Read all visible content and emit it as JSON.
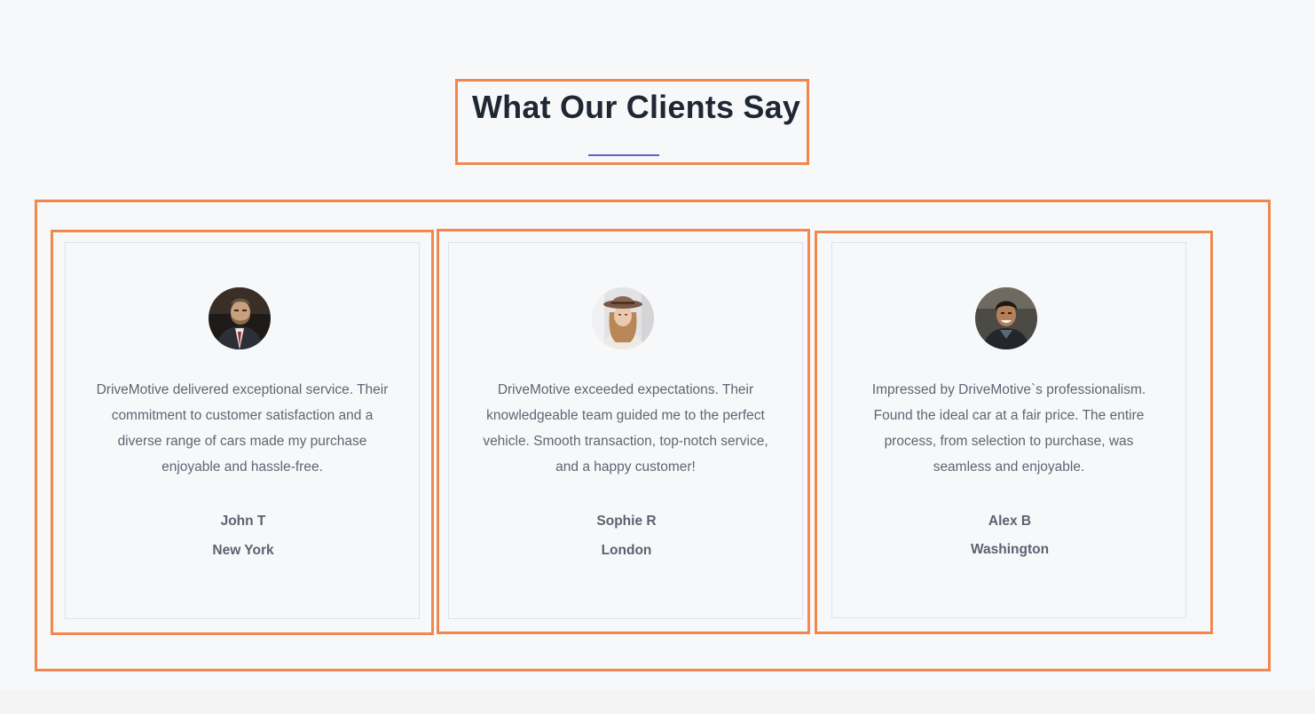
{
  "section": {
    "title": "What Our Clients Say",
    "accent_color": "#5a63c9",
    "highlight_color": "#f0884e"
  },
  "testimonials": [
    {
      "avatar_icon": "bearded-man-portrait",
      "quote": "DriveMotive delivered exceptional service. Their commitment to customer satisfaction and a diverse range of cars made my purchase enjoyable and hassle-free.",
      "name": "John T",
      "city": "New York"
    },
    {
      "avatar_icon": "woman-with-hat-portrait",
      "quote": "DriveMotive exceeded expectations. Their knowledgeable team guided me to the perfect vehicle. Smooth transaction, top-notch service, and a happy customer!",
      "name": "Sophie R",
      "city": "London"
    },
    {
      "avatar_icon": "smiling-man-portrait",
      "quote": "Impressed by DriveMotive`s professionalism. Found the ideal car at a fair price. The entire process, from selection to purchase, was seamless and enjoyable.",
      "name": "Alex B",
      "city": "Washington"
    }
  ]
}
